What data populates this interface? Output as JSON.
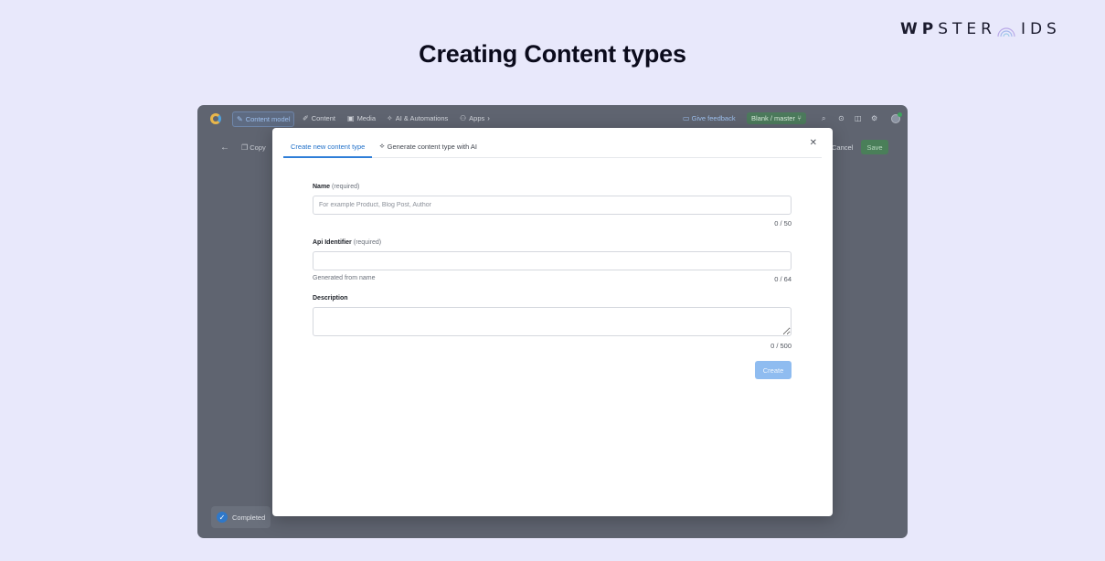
{
  "brand": {
    "bold": "WP",
    "light_start": "STER",
    "light_end": "IDS"
  },
  "page_title": "Creating Content types",
  "app": {
    "nav": {
      "content_model": "Content model",
      "content": "Content",
      "media": "Media",
      "ai_automations": "AI & Automations",
      "apps": "Apps"
    },
    "feedback": "Give feedback",
    "env": {
      "space": "Blank",
      "separator": "/",
      "branch": "master"
    },
    "subbar": {
      "copy": "Copy",
      "cancel": "Cancel",
      "save": "Save"
    },
    "status": "Completed"
  },
  "modal": {
    "tabs": [
      {
        "label": "Create new content type"
      },
      {
        "label": "Generate content type with AI"
      }
    ],
    "fields": {
      "name": {
        "label": "Name",
        "required": "(required)",
        "placeholder": "For example Product, Blog Post, Author",
        "counter": "0 / 50"
      },
      "api_identifier": {
        "label": "Api Identifier",
        "required": "(required)",
        "help": "Generated from name",
        "counter": "0 / 64"
      },
      "description": {
        "label": "Description",
        "counter": "0 / 500"
      }
    },
    "create_label": "Create"
  },
  "colors": {
    "page_bg": "#e8e8fb",
    "accent": "#2f7ed8",
    "create_disabled": "#8fbcf0",
    "overlay": "#5f6470"
  }
}
